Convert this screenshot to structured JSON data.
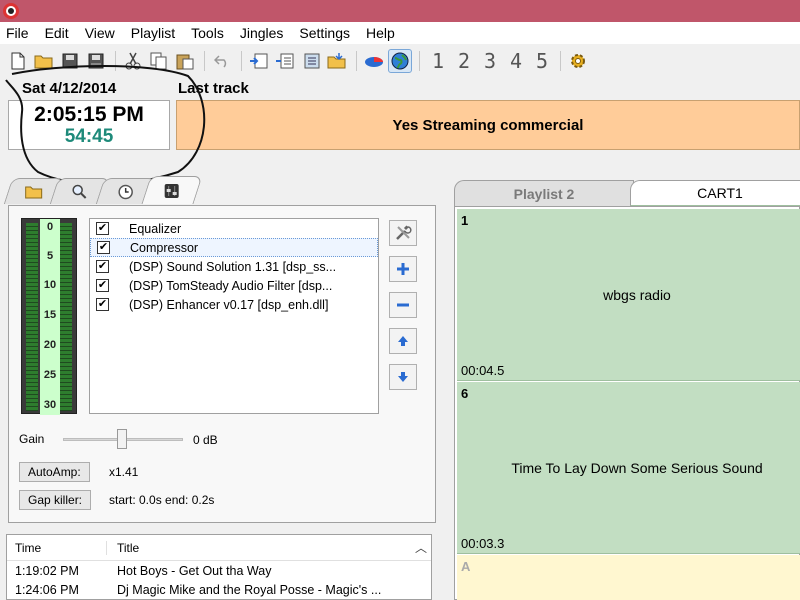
{
  "menu": [
    "File",
    "Edit",
    "View",
    "Playlist",
    "Tools",
    "Jingles",
    "Settings",
    "Help"
  ],
  "toolbar": {
    "icons": [
      "new-file-icon",
      "open-folder-icon",
      "save-icon",
      "save-all-icon",
      "cut-icon",
      "copy-icon",
      "paste-icon",
      "undo-icon",
      "insert-track-icon",
      "insert-list-icon",
      "insert-playlist-icon",
      "insert-folder-icon",
      "pie-chart-icon",
      "globe-icon",
      "settings-gear-icon"
    ],
    "numbers": [
      "1",
      "2",
      "3",
      "4",
      "5"
    ]
  },
  "clock": {
    "date": "Sat 4/12/2014",
    "time": "2:05:15 PM",
    "remaining": "54:45"
  },
  "last_track": {
    "label": "Last track",
    "title": "Yes Streaming commercial"
  },
  "left_tabs": [
    "folder-tab-icon",
    "search-tab-icon",
    "clock-tab-icon",
    "dsp-tab-icon"
  ],
  "vu_scale": [
    "0",
    "5",
    "10",
    "15",
    "20",
    "25",
    "30"
  ],
  "dsp_plugins": [
    {
      "name": "Equalizer",
      "checked": true,
      "selected": false
    },
    {
      "name": "Compressor",
      "checked": true,
      "selected": true
    },
    {
      "name": "(DSP) Sound Solution 1.31 [dsp_ss...",
      "checked": true,
      "selected": false
    },
    {
      "name": "(DSP) TomSteady Audio Filter [dsp...",
      "checked": true,
      "selected": false
    },
    {
      "name": "(DSP) Enhancer v0.17 [dsp_enh.dll]",
      "checked": true,
      "selected": false
    }
  ],
  "gain": {
    "label": "Gain",
    "value": "0 dB"
  },
  "autoamp": {
    "label": "AutoAmp:",
    "value": "x1.41"
  },
  "gapkiller": {
    "label": "Gap killer:",
    "value": "start: 0.0s end: 0.2s"
  },
  "history": {
    "columns": [
      "Time",
      "Title"
    ],
    "rows": [
      {
        "time": "1:19:02 PM",
        "title": "Hot Boys - Get Out tha Way"
      },
      {
        "time": "1:24:06 PM",
        "title": "Dj Magic Mike and the Royal Posse - Magic's ..."
      }
    ]
  },
  "right_tabs": [
    "Playlist 2",
    "CART1"
  ],
  "carts": [
    {
      "key": "1",
      "name": "wbgs radio",
      "duration": "00:04.5"
    },
    {
      "key": "6",
      "name": "Time To Lay Down Some Serious Sound",
      "duration": "00:03.3"
    },
    {
      "key": "A",
      "name": "",
      "duration": ""
    }
  ],
  "colors": {
    "titlebar": "#c0566a",
    "last_track_bg": "#ffcc99",
    "cart_green": "#c2dec2",
    "cart_yellow": "#fff7d0",
    "remaining_text": "#1e8a7a"
  }
}
